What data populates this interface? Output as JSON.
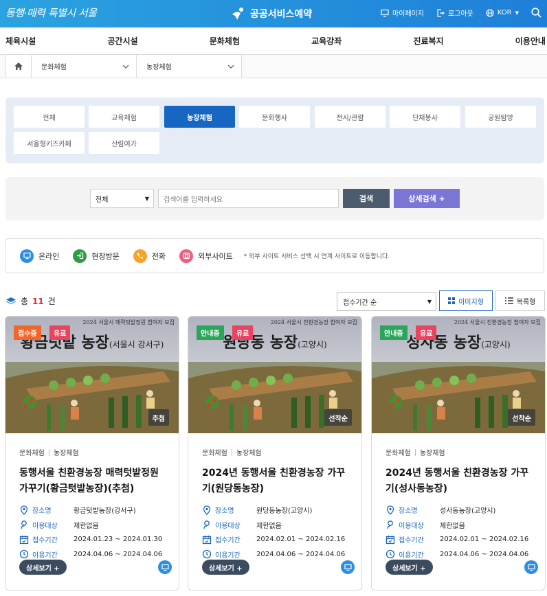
{
  "header": {
    "slogan": "동행·매력 특별시 서울",
    "brand": "공공서비스예약",
    "mypage": "마이페이지",
    "logout": "로그아웃",
    "lang": "KOR"
  },
  "gnb": [
    "체육시설",
    "공간시설",
    "문화체험",
    "교육강좌",
    "진료복지",
    "이용안내"
  ],
  "breadcrumb": {
    "level1": "문화체험",
    "level2": "농장체험"
  },
  "categories": [
    "전체",
    "교육체험",
    "농장체험",
    "문화행사",
    "전시/관람",
    "단체봉사",
    "공원탐방",
    "서울형키즈카페",
    "산림여가"
  ],
  "active_category": "농장체험",
  "search": {
    "select": "전체",
    "placeholder": "검색어를 입력하세요",
    "button": "검색",
    "advanced": "상세검색 +"
  },
  "legend": {
    "online": "온라인",
    "visit": "현장방문",
    "phone": "전화",
    "external": "외부사이트",
    "note": "* 외부 사이트 서비스 선택 시 연계 사이트로 이동합니다."
  },
  "results": {
    "total_prefix": "총",
    "total_count": "11",
    "total_suffix": "건",
    "sort": "접수기간 순",
    "image_view": "이미지형",
    "list_view": "목록형"
  },
  "labels": {
    "place": "장소명",
    "target": "이용대상",
    "reception": "접수기간",
    "usage": "이용기간",
    "detail": "상세보기 +"
  },
  "cards": [
    {
      "banner_top": "2024 서울시 매력텃밭정원 참여자 모집",
      "banner_title": "황금텃밭 농장",
      "banner_region": "(서울시 강서구)",
      "status": "접수중",
      "fee": "유료",
      "method": "추첨",
      "category1": "문화체험",
      "category2": "농장체험",
      "title": "동행서울 친환경농장 매력텃밭정원 가꾸기(황금텃밭농장)(추첨)",
      "place": "황금텃밭농장(강서구)",
      "target": "제한없음",
      "reception": "2024.01.23 ~ 2024.01.30",
      "usage": "2024.04.06 ~ 2024.04.06"
    },
    {
      "banner_top": "2024 서울시 친환경농장 참여자 모집",
      "banner_title": "원당동 농장",
      "banner_region": "(고양시)",
      "status": "안내중",
      "fee": "유료",
      "method": "선착순",
      "category1": "문화체험",
      "category2": "농장체험",
      "title": "2024년 동행서울 친환경농장 가꾸기(원당동농장)",
      "place": "원당동농장(고양시)",
      "target": "제한없음",
      "reception": "2024.02.01 ~ 2024.02.16",
      "usage": "2024.04.06 ~ 2024.04.06"
    },
    {
      "banner_top": "2024 서울시 친환경농장 참여자 모집",
      "banner_title": "성사동 농장",
      "banner_region": "(고양시)",
      "status": "안내중",
      "fee": "유료",
      "method": "선착순",
      "category1": "문화체험",
      "category2": "농장체험",
      "title": "2024년 동행서울 친환경농장 가꾸기(성사동농장)",
      "place": "성사동농장(고양시)",
      "target": "제한없음",
      "reception": "2024.02.01 ~ 2024.02.16",
      "usage": "2024.04.06 ~ 2024.04.06"
    }
  ],
  "colors": {
    "primary": "#1766c2",
    "status_open": "#f2662b",
    "status_info": "#2aa55a",
    "fee": "#e8435f",
    "advanced": "#7a76d6"
  }
}
